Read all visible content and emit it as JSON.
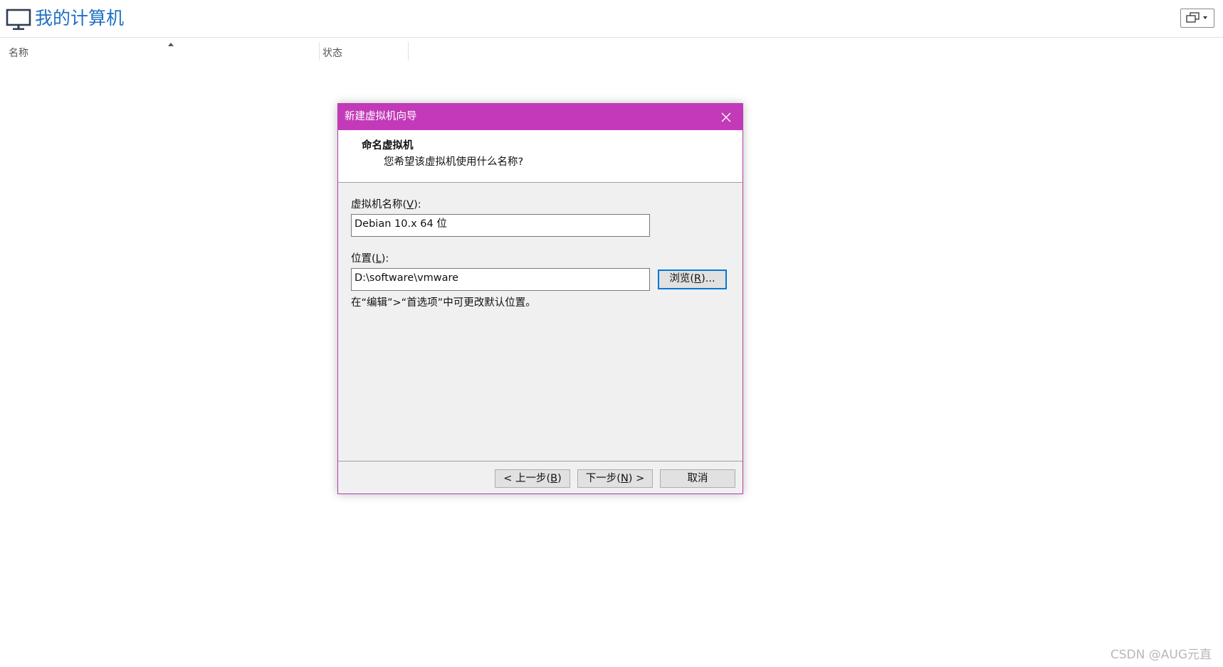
{
  "header": {
    "title": "我的计算机",
    "icon": "monitor-icon",
    "view_button_icon": "view-mode-icon"
  },
  "columns": {
    "name": "名称",
    "status": "状态"
  },
  "dialog": {
    "title": "新建虚拟机向导",
    "banner_title": "命名虚拟机",
    "banner_subtitle": "您希望该虚拟机使用什么名称?",
    "name_label_prefix": "虚拟机名称(",
    "name_label_key": "V",
    "name_label_suffix": "):",
    "name_value": "Debian 10.x 64 位",
    "location_label_prefix": "位置(",
    "location_label_key": "L",
    "location_label_suffix": "):",
    "location_value": "D:\\software\\vmware",
    "browse_prefix": "浏览(",
    "browse_key": "R",
    "browse_suffix": ")...",
    "hint": "在“编辑”>“首选项”中可更改默认位置。",
    "back_prefix": "< 上一步(",
    "back_key": "B",
    "back_suffix": ")",
    "next_prefix": "下一步(",
    "next_key": "N",
    "next_suffix": ") >",
    "cancel_label": "取消",
    "titlebar_color": "#c23ab8"
  },
  "watermark": "CSDN @AUG元直"
}
